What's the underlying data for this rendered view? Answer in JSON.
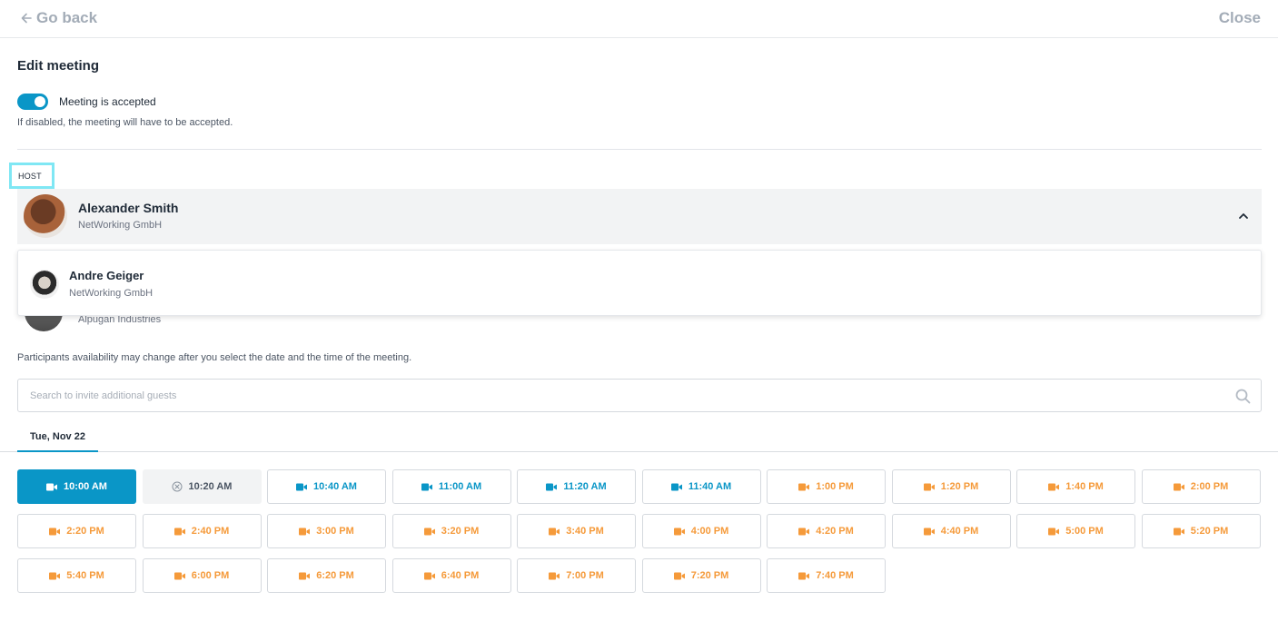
{
  "header": {
    "back_label": "Go back",
    "close_label": "Close"
  },
  "title": "Edit meeting",
  "acceptance": {
    "toggle_on": true,
    "label": "Meeting is accepted",
    "help_text": "If disabled, the meeting will have to be accepted."
  },
  "host": {
    "section_label": "HOST",
    "selected": {
      "name": "Alexander Smith",
      "company": "NetWorking GmbH"
    },
    "options": [
      {
        "name": "Andre Geiger",
        "company": "NetWorking GmbH"
      }
    ]
  },
  "participant_behind": {
    "company": "Alpugan Industries"
  },
  "availability_note": "Participants availability may change after you select the date and the time of the meeting.",
  "search": {
    "placeholder": "Search to invite additional guests",
    "value": ""
  },
  "date_tabs": [
    {
      "label": "Tue, Nov 22",
      "active": true
    }
  ],
  "colors": {
    "accent": "#0a96c7",
    "orange": "#f59a3a",
    "unavailable_bg": "#f2f3f4"
  },
  "time_slots": [
    {
      "time": "10:00 AM",
      "status": "selected",
      "icon": "video-icon"
    },
    {
      "time": "10:20 AM",
      "status": "unavailable",
      "icon": "x-circle-icon"
    },
    {
      "time": "10:40 AM",
      "status": "teal",
      "icon": "video-icon"
    },
    {
      "time": "11:00 AM",
      "status": "teal",
      "icon": "video-icon"
    },
    {
      "time": "11:20 AM",
      "status": "teal",
      "icon": "video-icon"
    },
    {
      "time": "11:40 AM",
      "status": "teal",
      "icon": "video-icon"
    },
    {
      "time": "1:00 PM",
      "status": "orange",
      "icon": "video-icon"
    },
    {
      "time": "1:20 PM",
      "status": "orange",
      "icon": "video-icon"
    },
    {
      "time": "1:40 PM",
      "status": "orange",
      "icon": "video-icon"
    },
    {
      "time": "2:00 PM",
      "status": "orange",
      "icon": "video-icon"
    },
    {
      "time": "2:20 PM",
      "status": "orange",
      "icon": "video-icon"
    },
    {
      "time": "2:40 PM",
      "status": "orange",
      "icon": "video-icon"
    },
    {
      "time": "3:00 PM",
      "status": "orange",
      "icon": "video-icon"
    },
    {
      "time": "3:20 PM",
      "status": "orange",
      "icon": "video-icon"
    },
    {
      "time": "3:40 PM",
      "status": "orange",
      "icon": "video-icon"
    },
    {
      "time": "4:00 PM",
      "status": "orange",
      "icon": "video-icon"
    },
    {
      "time": "4:20 PM",
      "status": "orange",
      "icon": "video-icon"
    },
    {
      "time": "4:40 PM",
      "status": "orange",
      "icon": "video-icon"
    },
    {
      "time": "5:00 PM",
      "status": "orange",
      "icon": "video-icon"
    },
    {
      "time": "5:20 PM",
      "status": "orange",
      "icon": "video-icon"
    },
    {
      "time": "5:40 PM",
      "status": "orange",
      "icon": "video-icon"
    },
    {
      "time": "6:00 PM",
      "status": "orange",
      "icon": "video-icon"
    },
    {
      "time": "6:20 PM",
      "status": "orange",
      "icon": "video-icon"
    },
    {
      "time": "6:40 PM",
      "status": "orange",
      "icon": "video-icon"
    },
    {
      "time": "7:00 PM",
      "status": "orange",
      "icon": "video-icon"
    },
    {
      "time": "7:20 PM",
      "status": "orange",
      "icon": "video-icon"
    },
    {
      "time": "7:40 PM",
      "status": "orange",
      "icon": "video-icon"
    }
  ]
}
